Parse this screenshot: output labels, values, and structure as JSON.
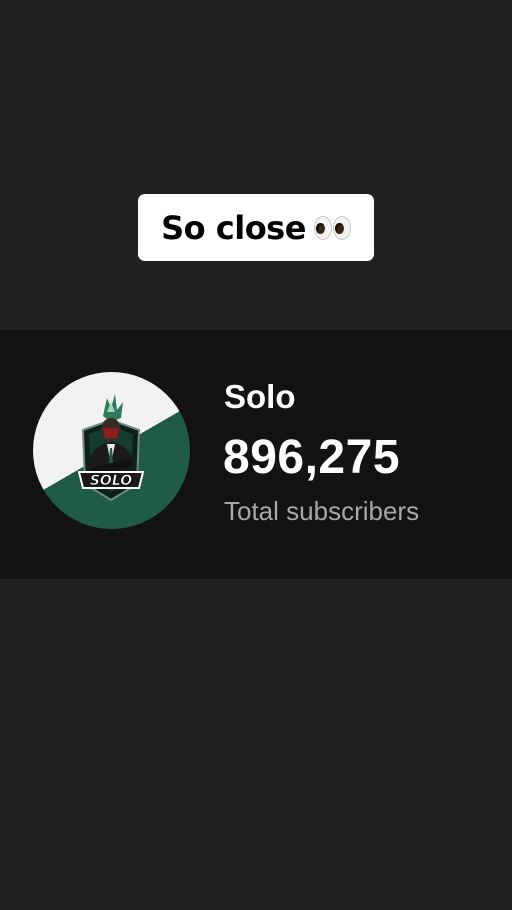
{
  "caption": {
    "text": "So close",
    "emoji": "eyes-emoji"
  },
  "channel": {
    "name": "Solo",
    "subscriber_count": "896,275",
    "subscriber_label": "Total subscribers",
    "avatar": {
      "logo_text": "SOLO",
      "colors": {
        "light": "#f2f2f2",
        "accent": "#1f5b46"
      }
    }
  },
  "colors": {
    "background": "#212121",
    "card_background": "#121212",
    "caption_background": "#ffffff",
    "secondary_text": "#a8a8a8"
  }
}
